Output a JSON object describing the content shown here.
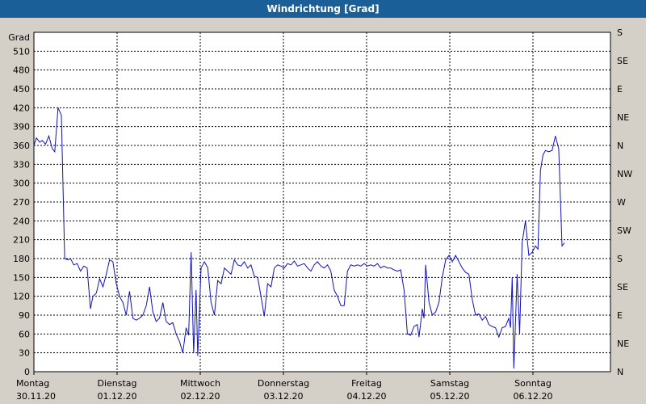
{
  "window": {
    "title": "Windrichtung [Grad]"
  },
  "chart_data": {
    "type": "line",
    "title": "Windrichtung [Grad]",
    "ylabel": "Grad",
    "ylim": [
      0,
      540
    ],
    "y_ticks": [
      0,
      30,
      60,
      90,
      120,
      150,
      180,
      210,
      240,
      270,
      300,
      330,
      360,
      390,
      420,
      450,
      480,
      510
    ],
    "right_axis_labels": [
      "N",
      "NE",
      "E",
      "SE",
      "S",
      "SW",
      "W",
      "NW",
      "N",
      "NE",
      "E",
      "SE",
      "S"
    ],
    "x_ticks": [
      {
        "day": "Montag",
        "date": "30.11.20"
      },
      {
        "day": "Dienstag",
        "date": "01.12.20"
      },
      {
        "day": "Mittwoch",
        "date": "02.12.20"
      },
      {
        "day": "Donnerstag",
        "date": "03.12.20"
      },
      {
        "day": "Freitag",
        "date": "04.12.20"
      },
      {
        "day": "Samstag",
        "date": "05.12.20"
      },
      {
        "day": "Sonntag",
        "date": "06.12.20"
      }
    ],
    "grid": true,
    "line_color": "#1010c0",
    "series": [
      {
        "values": [
          [
            0.0,
            360
          ],
          [
            0.03,
            372
          ],
          [
            0.07,
            365
          ],
          [
            0.1,
            368
          ],
          [
            0.14,
            362
          ],
          [
            0.18,
            375
          ],
          [
            0.22,
            355
          ],
          [
            0.25,
            350
          ],
          [
            0.29,
            420
          ],
          [
            0.33,
            408
          ],
          [
            0.37,
            180
          ],
          [
            0.41,
            178
          ],
          [
            0.44,
            180
          ],
          [
            0.48,
            170
          ],
          [
            0.52,
            172
          ],
          [
            0.56,
            160
          ],
          [
            0.6,
            168
          ],
          [
            0.64,
            165
          ],
          [
            0.68,
            100
          ],
          [
            0.71,
            120
          ],
          [
            0.75,
            125
          ],
          [
            0.79,
            148
          ],
          [
            0.83,
            135
          ],
          [
            0.87,
            155
          ],
          [
            0.91,
            178
          ],
          [
            0.95,
            175
          ],
          [
            0.99,
            140
          ],
          [
            1.03,
            120
          ],
          [
            1.07,
            110
          ],
          [
            1.11,
            90
          ],
          [
            1.15,
            128
          ],
          [
            1.19,
            85
          ],
          [
            1.23,
            82
          ],
          [
            1.27,
            85
          ],
          [
            1.31,
            90
          ],
          [
            1.35,
            105
          ],
          [
            1.39,
            135
          ],
          [
            1.43,
            95
          ],
          [
            1.47,
            80
          ],
          [
            1.51,
            85
          ],
          [
            1.55,
            110
          ],
          [
            1.59,
            80
          ],
          [
            1.63,
            75
          ],
          [
            1.67,
            78
          ],
          [
            1.71,
            60
          ],
          [
            1.75,
            48
          ],
          [
            1.79,
            30
          ],
          [
            1.83,
            70
          ],
          [
            1.86,
            58
          ],
          [
            1.89,
            190
          ],
          [
            1.92,
            30
          ],
          [
            1.95,
            130
          ],
          [
            1.97,
            25
          ],
          [
            2.01,
            165
          ],
          [
            2.05,
            175
          ],
          [
            2.09,
            165
          ],
          [
            2.13,
            110
          ],
          [
            2.17,
            90
          ],
          [
            2.21,
            145
          ],
          [
            2.25,
            140
          ],
          [
            2.29,
            165
          ],
          [
            2.33,
            160
          ],
          [
            2.37,
            155
          ],
          [
            2.41,
            178
          ],
          [
            2.45,
            170
          ],
          [
            2.49,
            168
          ],
          [
            2.53,
            175
          ],
          [
            2.57,
            165
          ],
          [
            2.61,
            170
          ],
          [
            2.65,
            152
          ],
          [
            2.69,
            150
          ],
          [
            2.73,
            120
          ],
          [
            2.77,
            88
          ],
          [
            2.81,
            140
          ],
          [
            2.85,
            135
          ],
          [
            2.89,
            165
          ],
          [
            2.93,
            170
          ],
          [
            2.97,
            168
          ],
          [
            3.01,
            165
          ],
          [
            3.05,
            172
          ],
          [
            3.09,
            170
          ],
          [
            3.13,
            176
          ],
          [
            3.17,
            168
          ],
          [
            3.21,
            170
          ],
          [
            3.25,
            172
          ],
          [
            3.29,
            165
          ],
          [
            3.33,
            160
          ],
          [
            3.37,
            170
          ],
          [
            3.41,
            175
          ],
          [
            3.45,
            168
          ],
          [
            3.49,
            165
          ],
          [
            3.53,
            170
          ],
          [
            3.57,
            160
          ],
          [
            3.61,
            130
          ],
          [
            3.65,
            120
          ],
          [
            3.69,
            105
          ],
          [
            3.73,
            105
          ],
          [
            3.77,
            160
          ],
          [
            3.81,
            170
          ],
          [
            3.85,
            168
          ],
          [
            3.89,
            170
          ],
          [
            3.93,
            168
          ],
          [
            3.97,
            172
          ],
          [
            4.01,
            168
          ],
          [
            4.05,
            170
          ],
          [
            4.09,
            168
          ],
          [
            4.13,
            172
          ],
          [
            4.17,
            165
          ],
          [
            4.21,
            168
          ],
          [
            4.25,
            165
          ],
          [
            4.29,
            165
          ],
          [
            4.33,
            162
          ],
          [
            4.37,
            160
          ],
          [
            4.41,
            162
          ],
          [
            4.45,
            130
          ],
          [
            4.49,
            60
          ],
          [
            4.53,
            58
          ],
          [
            4.57,
            72
          ],
          [
            4.61,
            75
          ],
          [
            4.63,
            55
          ],
          [
            4.67,
            100
          ],
          [
            4.69,
            85
          ],
          [
            4.71,
            170
          ],
          [
            4.75,
            110
          ],
          [
            4.79,
            90
          ],
          [
            4.83,
            95
          ],
          [
            4.87,
            110
          ],
          [
            4.91,
            150
          ],
          [
            4.95,
            178
          ],
          [
            4.99,
            185
          ],
          [
            5.03,
            175
          ],
          [
            5.07,
            185
          ],
          [
            5.11,
            175
          ],
          [
            5.15,
            165
          ],
          [
            5.19,
            158
          ],
          [
            5.23,
            155
          ],
          [
            5.27,
            115
          ],
          [
            5.31,
            90
          ],
          [
            5.35,
            92
          ],
          [
            5.39,
            82
          ],
          [
            5.43,
            88
          ],
          [
            5.47,
            75
          ],
          [
            5.51,
            72
          ],
          [
            5.55,
            70
          ],
          [
            5.59,
            55
          ],
          [
            5.63,
            70
          ],
          [
            5.67,
            72
          ],
          [
            5.71,
            85
          ],
          [
            5.73,
            70
          ],
          [
            5.75,
            150
          ],
          [
            5.77,
            5
          ],
          [
            5.79,
            80
          ],
          [
            5.81,
            155
          ],
          [
            5.84,
            60
          ],
          [
            5.87,
            205
          ],
          [
            5.91,
            240
          ],
          [
            5.95,
            185
          ],
          [
            5.99,
            190
          ],
          [
            6.03,
            200
          ],
          [
            6.06,
            195
          ],
          [
            6.09,
            320
          ],
          [
            6.12,
            345
          ],
          [
            6.15,
            352
          ],
          [
            6.19,
            350
          ],
          [
            6.23,
            352
          ],
          [
            6.27,
            375
          ],
          [
            6.31,
            355
          ],
          [
            6.35,
            200
          ],
          [
            6.38,
            205
          ]
        ]
      }
    ]
  }
}
